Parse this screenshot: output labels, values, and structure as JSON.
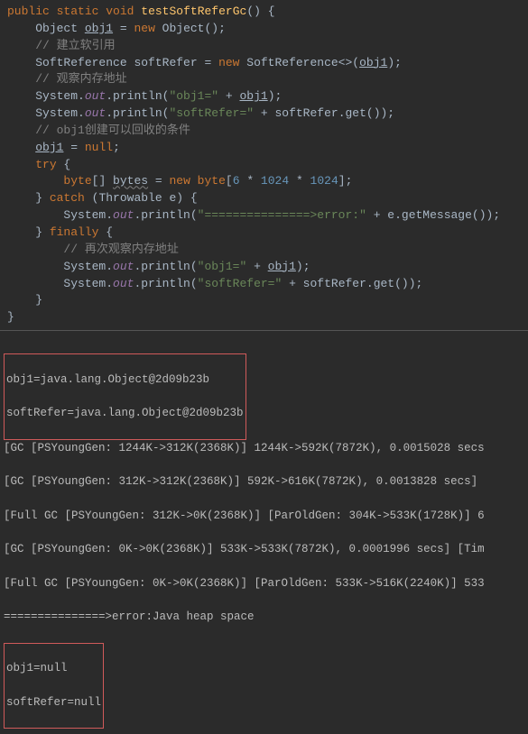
{
  "code": {
    "l1_kw1": "public",
    "l1_kw2": "static",
    "l1_kw3": "void",
    "l1_mname": "testSoftReferGc",
    "l1_paren": "() {",
    "l2_type": "Object",
    "l2_var": "obj1",
    "l2_eq": " = ",
    "l2_new": "new",
    "l2_ctor": " Object();",
    "l3_c": "// 建立软引用",
    "l4_type": "SoftReference",
    "l4_var": " softRefer = ",
    "l4_new": "new",
    "l4_ctor": " SoftReference<>(",
    "l4_arg": "obj1",
    "l4_end": ");",
    "l5_c": "// 观察内存地址",
    "l6_sys": "System.",
    "l6_out": "out",
    "l6_dot": ".println(",
    "l6_str": "\"obj1=\"",
    "l6_plus": " + ",
    "l6_arg": "obj1",
    "l6_end": ");",
    "l7_sys": "System.",
    "l7_out": "out",
    "l7_dot": ".println(",
    "l7_str": "\"softRefer=\"",
    "l7_plus": " + softRefer.get());",
    "l8_c": "// obj1创建可以回收的条件",
    "l9_var": "obj1",
    "l9_eq": " = ",
    "l9_null": "null",
    "l9_end": ";",
    "l10_try": "try",
    "l10_b": " {",
    "l11_type": "byte",
    "l11_arr": "[] ",
    "l11_var": "bytes",
    "l11_eq": " = ",
    "l11_new": "new",
    "l11_t2": " byte",
    "l11_br": "[",
    "l11_n1": "6",
    "l11_m1": " * ",
    "l11_n2": "1024",
    "l11_m2": " * ",
    "l11_n3": "1024",
    "l11_end": "];",
    "l12_c": "} ",
    "l12_catch": "catch",
    "l12_p": " (Throwable e) {",
    "l13_sys": "System.",
    "l13_out": "out",
    "l13_dot": ".println(",
    "l13_str": "\"===============>error:\"",
    "l13_plus": " + e.getMessage());",
    "l14_c": "} ",
    "l14_fin": "finally",
    "l14_b": " {",
    "l15_c": "// 再次观察内存地址",
    "l16_sys": "System.",
    "l16_out": "out",
    "l16_dot": ".println(",
    "l16_str": "\"obj1=\"",
    "l16_plus": " + ",
    "l16_arg": "obj1",
    "l16_end": ");",
    "l17_sys": "System.",
    "l17_out": "out",
    "l17_dot": ".println(",
    "l17_str": "\"softRefer=\"",
    "l17_plus": " + softRefer.get());",
    "l18": "}",
    "l19": "}"
  },
  "console": {
    "r1a": "obj1=java.lang.Object@2d09b23b",
    "r1b": "softRefer=java.lang.Object@2d09b23b",
    "g1": "[GC [PSYoungGen: 1244K->312K(2368K)] 1244K->592K(7872K), 0.0015028 secs",
    "g2": "[GC [PSYoungGen: 312K->312K(2368K)] 592K->616K(7872K), 0.0013828 secs]",
    "g3": "[Full GC [PSYoungGen: 312K->0K(2368K)] [ParOldGen: 304K->533K(1728K)] 6",
    "g4": "[GC [PSYoungGen: 0K->0K(2368K)] 533K->533K(7872K), 0.0001996 secs] [Tim",
    "g5": "[Full GC [PSYoungGen: 0K->0K(2368K)] [ParOldGen: 533K->516K(2240K)] 533",
    "err": "===============>error:Java heap space",
    "r2a": "obj1=null",
    "r2b": "softRefer=null"
  }
}
